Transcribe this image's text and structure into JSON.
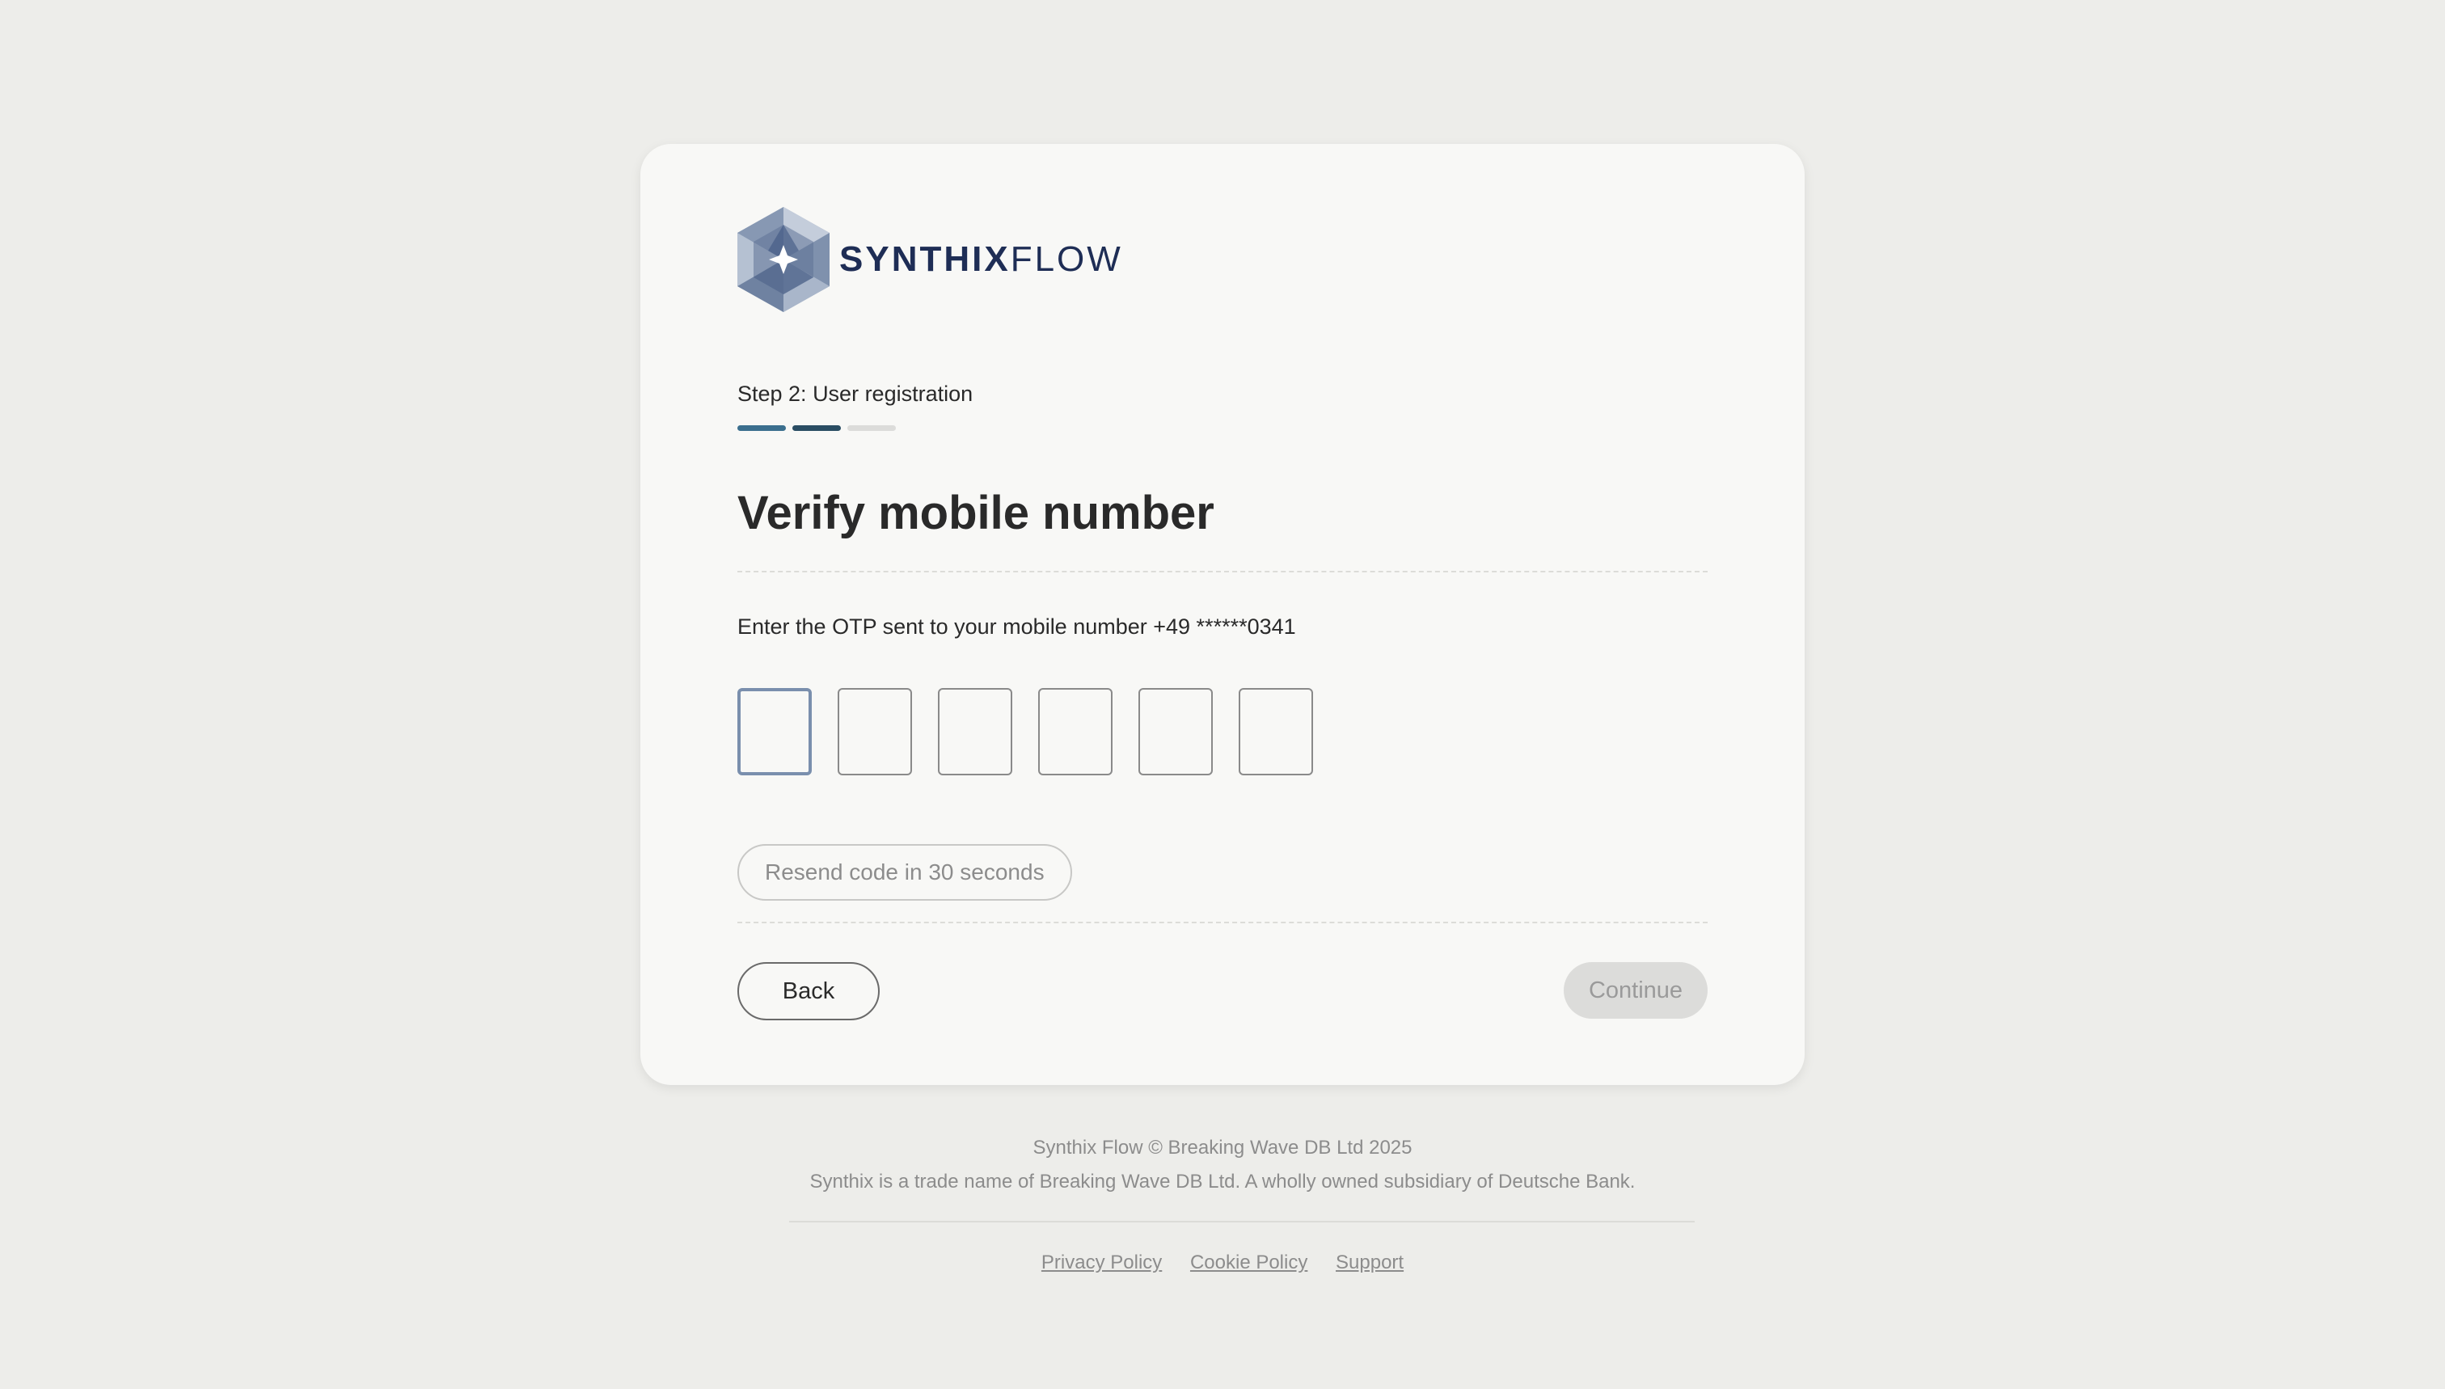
{
  "brand": {
    "name_bold": "SYNTHIX",
    "name_light": "FLOW",
    "logo_icon": "hexagon-star-logo-icon",
    "color_primary": "#1e2d55"
  },
  "step": {
    "label": "Step 2: User registration",
    "total": 3,
    "completed": 2
  },
  "page": {
    "title": "Verify mobile number",
    "instruction": "Enter the OTP sent to your mobile number +49 ******0341"
  },
  "otp": {
    "digits": [
      "",
      "",
      "",
      "",
      "",
      ""
    ]
  },
  "resend": {
    "label": "Resend code in 30 seconds"
  },
  "actions": {
    "back_label": "Back",
    "continue_label": "Continue"
  },
  "footer": {
    "copyright": "Synthix Flow © Breaking Wave DB Ltd 2025",
    "legal": "Synthix is a trade name of Breaking Wave DB Ltd. A wholly owned subsidiary of Deutsche Bank.",
    "links": {
      "privacy": "Privacy Policy",
      "cookie": "Cookie Policy",
      "support": "Support"
    }
  }
}
